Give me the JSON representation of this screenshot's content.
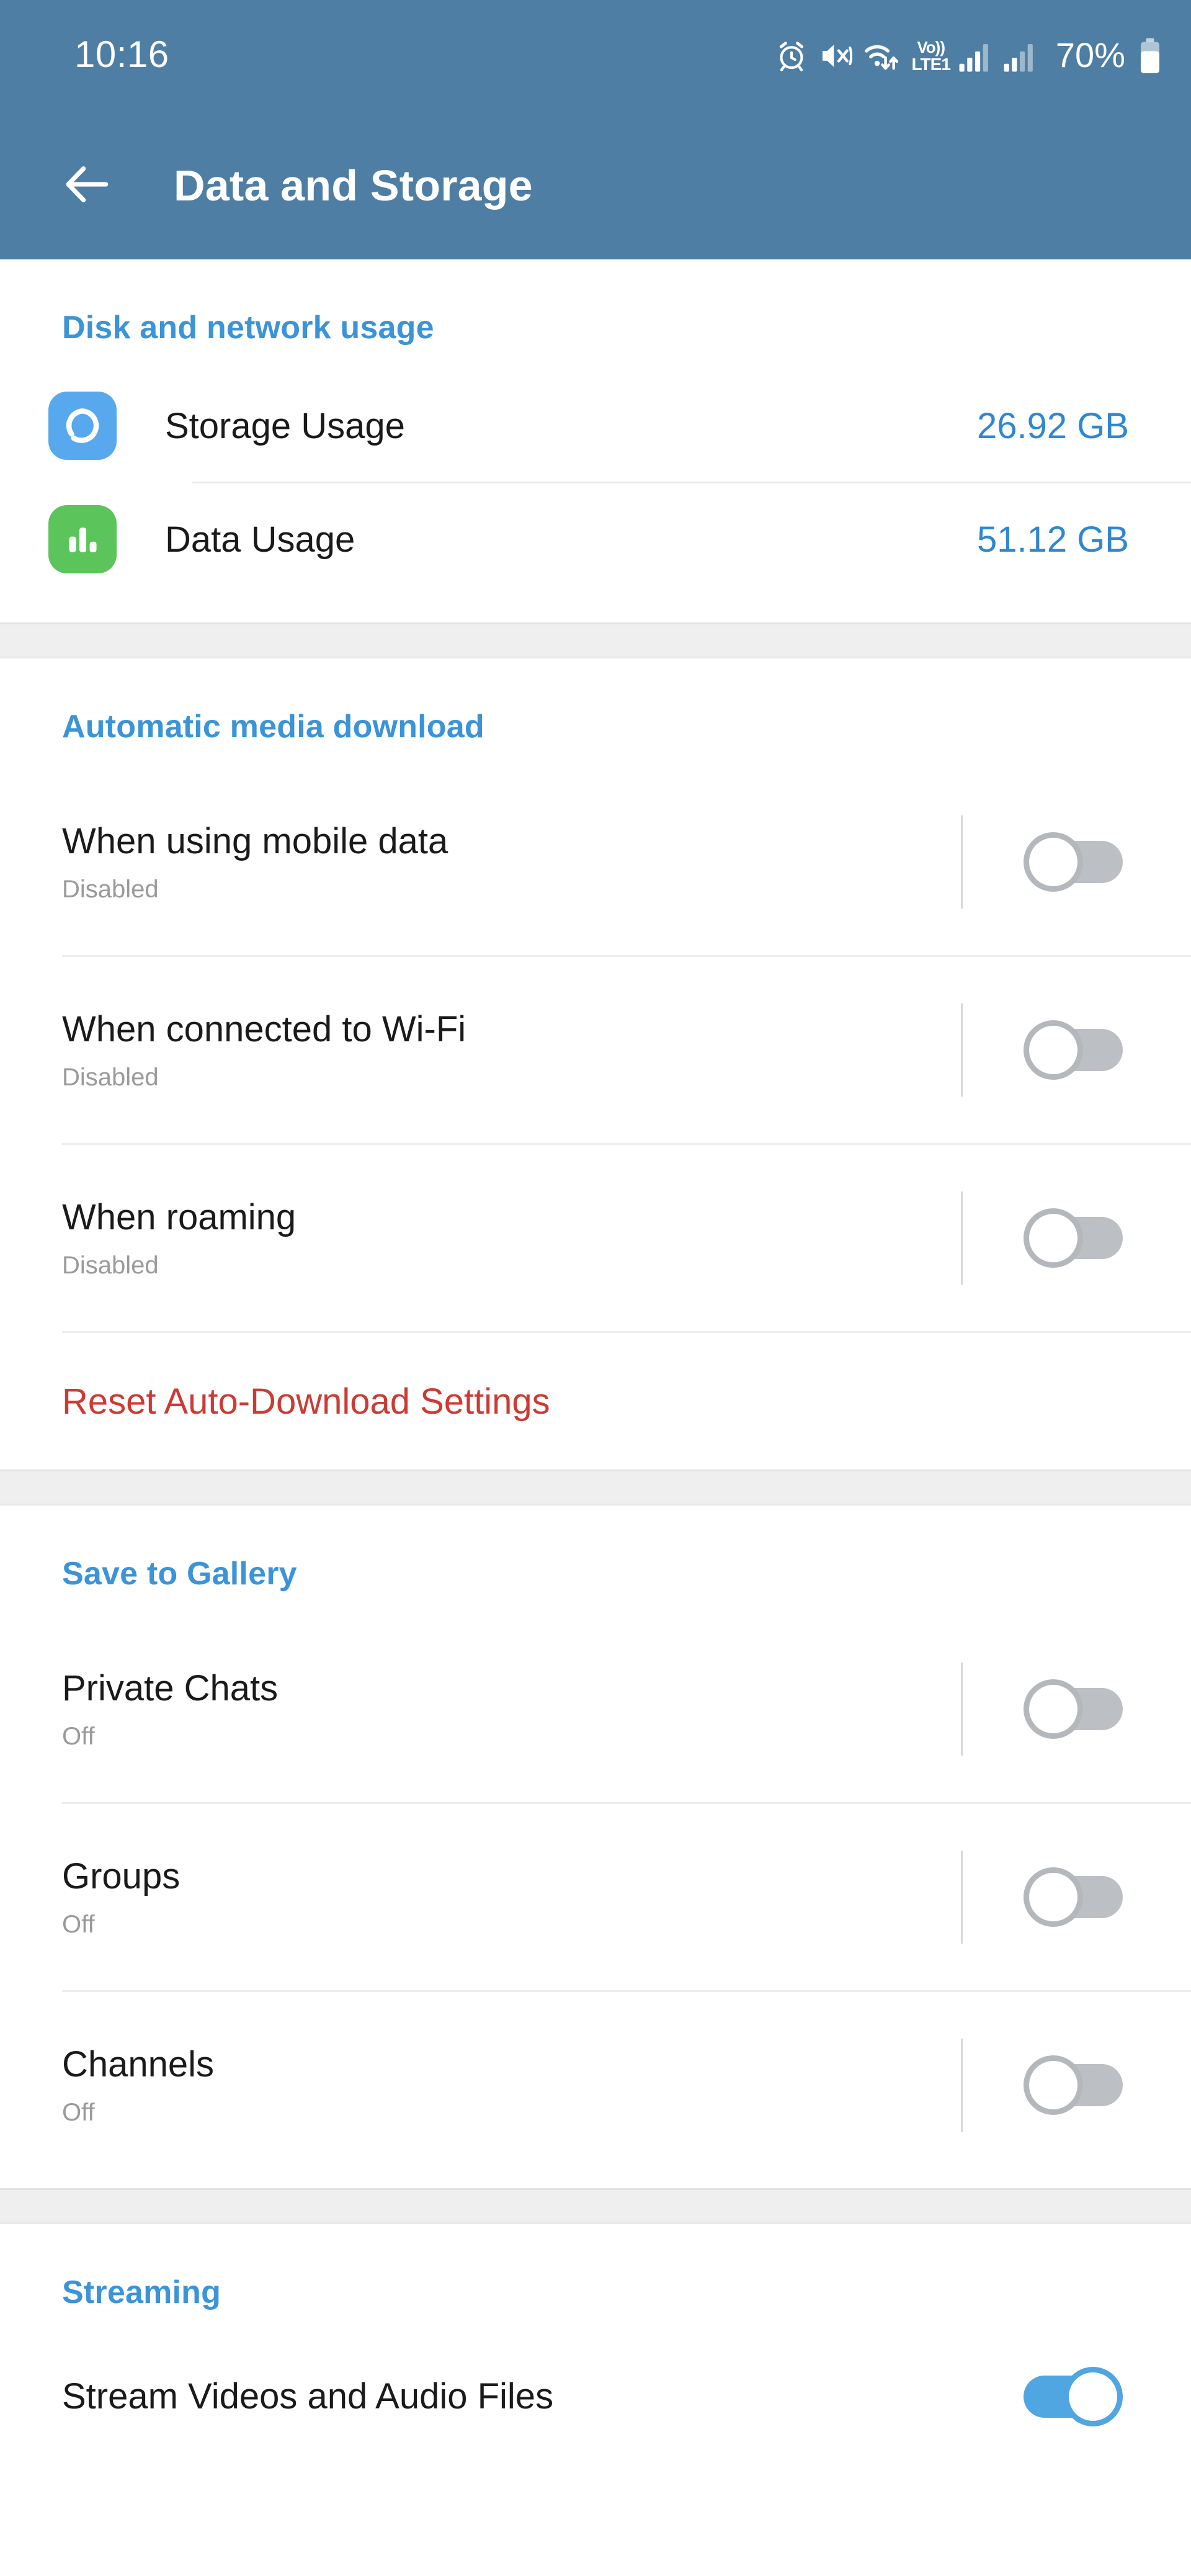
{
  "status_bar": {
    "time": "10:16",
    "battery_percent": "70%",
    "volte_label_top": "Vo))",
    "volte_label_bottom": "LTE1",
    "icons": [
      "alarm-icon",
      "vibrate-mute-icon",
      "wifi-transfer-icon",
      "volte-icon",
      "signal-sim1-icon",
      "signal-sim2-icon",
      "battery-icon"
    ]
  },
  "app_bar": {
    "title": "Data and Storage",
    "back_icon": "back-arrow-icon"
  },
  "sections": {
    "disk": {
      "header": "Disk and network usage",
      "rows": [
        {
          "label": "Storage Usage",
          "value": "26.92 GB",
          "icon": "storage-pie-icon"
        },
        {
          "label": "Data Usage",
          "value": "51.12 GB",
          "icon": "data-bars-icon"
        }
      ]
    },
    "auto_download": {
      "header": "Automatic media download",
      "rows": [
        {
          "title": "When using mobile data",
          "subtitle": "Disabled",
          "state": "off"
        },
        {
          "title": "When connected to Wi-Fi",
          "subtitle": "Disabled",
          "state": "off"
        },
        {
          "title": "When roaming",
          "subtitle": "Disabled",
          "state": "off"
        }
      ],
      "reset_label": "Reset Auto-Download Settings"
    },
    "save_to_gallery": {
      "header": "Save to Gallery",
      "rows": [
        {
          "title": "Private Chats",
          "subtitle": "Off",
          "state": "off"
        },
        {
          "title": "Groups",
          "subtitle": "Off",
          "state": "off"
        },
        {
          "title": "Channels",
          "subtitle": "Off",
          "state": "off"
        }
      ]
    },
    "streaming": {
      "header": "Streaming",
      "rows": [
        {
          "title": "Stream Videos and Audio Files",
          "subtitle": "",
          "state": "on"
        }
      ]
    }
  },
  "colors": {
    "header_blue": "#4E7EA3",
    "accent_blue": "#3B93D8",
    "value_blue": "#2F87D0",
    "danger_red": "#CC3B33",
    "toggle_on": "#4FA6E0",
    "toggle_off": "#BCC0C4",
    "icon_blue": "#57A8EC",
    "icon_green": "#5BC45B"
  }
}
